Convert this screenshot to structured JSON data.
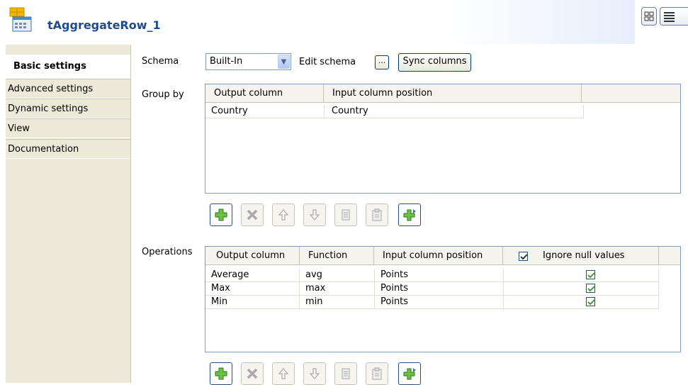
{
  "header": {
    "title": "tAggregateRow_1",
    "icon": "aggregate-component-icon"
  },
  "sidebar": {
    "tabs": [
      {
        "label": "Basic settings",
        "active": true
      },
      {
        "label": "Advanced settings",
        "active": false
      },
      {
        "label": "Dynamic settings",
        "active": false
      },
      {
        "label": "View",
        "active": false
      },
      {
        "label": "Documentation",
        "active": false
      }
    ]
  },
  "schema": {
    "label": "Schema",
    "value": "Built-In",
    "edit_label": "Edit schema",
    "edit_button": "...",
    "sync_button": "Sync columns"
  },
  "group_by": {
    "label": "Group by",
    "columns": [
      "Output column",
      "Input column position"
    ],
    "rows": [
      [
        "Country",
        "Country"
      ]
    ]
  },
  "operations": {
    "label": "Operations",
    "columns": [
      "Output column",
      "Function",
      "Input column position",
      "Ignore null values"
    ],
    "header_checkbox": true,
    "rows": [
      {
        "output": "Average",
        "function": "avg",
        "input": "Points",
        "ignore_null": true
      },
      {
        "output": "Max",
        "function": "max",
        "input": "Points",
        "ignore_null": true
      },
      {
        "output": "Min",
        "function": "min",
        "input": "Points",
        "ignore_null": true
      }
    ]
  },
  "toolbar_icons": [
    "add-icon",
    "delete-icon",
    "move-up-icon",
    "move-down-icon",
    "copy-icon",
    "paste-icon",
    "insert-icon"
  ]
}
